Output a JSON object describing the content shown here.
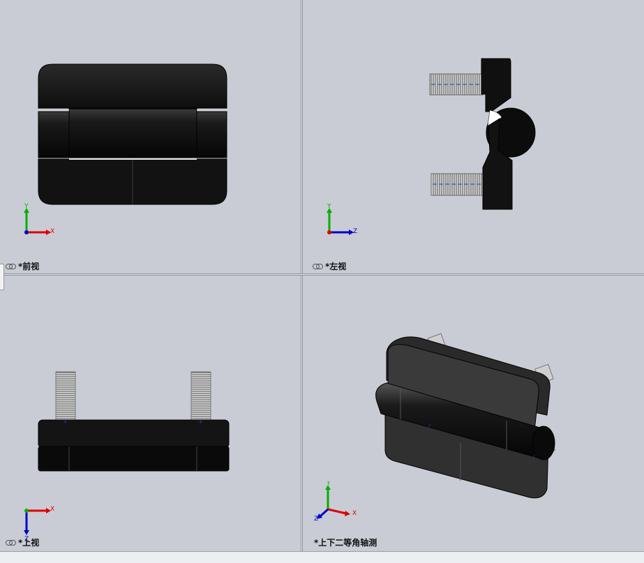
{
  "viewports": {
    "front": {
      "label": "*前视",
      "axis_h": "X",
      "axis_v": "Y"
    },
    "left": {
      "label": "*左视",
      "axis_h": "Z",
      "axis_v": "Y"
    },
    "top": {
      "label": "*上视",
      "axis_h": "X",
      "axis_v": "Z"
    },
    "iso": {
      "label": "*上下二等角轴测",
      "axis_x": "X",
      "axis_y": "Y",
      "axis_z": "Z"
    }
  },
  "toolbar": {
    "icons": [
      "zoom-to-fit-icon",
      "zoom-to-area-icon",
      "previous-view-icon",
      "section-view-icon",
      "dynamic-annotation-icon",
      "view-orientation-icon",
      "display-style-icon",
      "hide-show-items-icon",
      "edit-appearance-icon",
      "apply-scene-icon",
      "view-settings-icon"
    ]
  },
  "colors": {
    "background": "#c9ccd4",
    "part": "#111111",
    "axis_x": "#e00000",
    "axis_y": "#00b000",
    "axis_z": "#0000c8"
  }
}
